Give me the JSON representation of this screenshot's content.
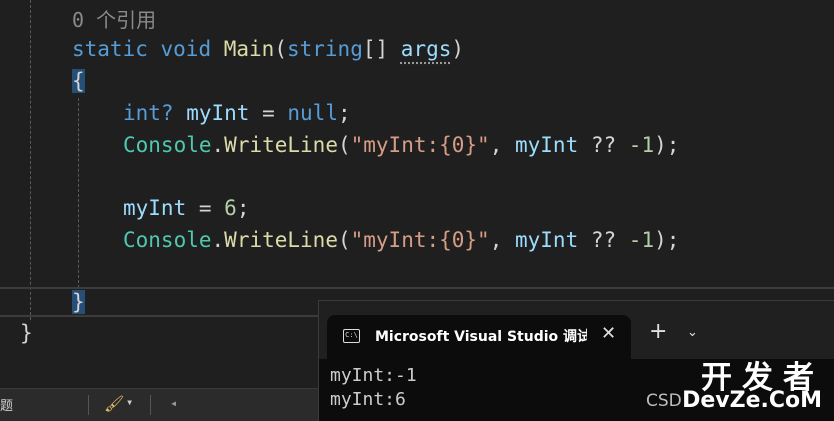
{
  "editor": {
    "codelens": "0 个引用",
    "lines": {
      "signature": {
        "kw1": "static",
        "kw2": "void",
        "fn": "Main",
        "p_open": "(",
        "kw3": "string",
        "arr": "[]",
        "param": "args",
        "p_close": ")"
      },
      "brace_open": "{",
      "line1": {
        "kw": "int?",
        "var": "myInt",
        "op": " = ",
        "val": "null",
        "end": ";"
      },
      "line2": {
        "type": "Console",
        "dot": ".",
        "fn": "WriteLine",
        "open": "(",
        "str": "\"myInt:{0}\"",
        "comma": ", ",
        "var": "myInt",
        "op": " ?? ",
        "num": "-1",
        "end": ");"
      },
      "line3": {
        "var": "myInt",
        "op": " = ",
        "num": "6",
        "end": ";"
      },
      "line4": {
        "type": "Console",
        "dot": ".",
        "fn": "WriteLine",
        "open": "(",
        "str": "\"myInt:{0}\"",
        "comma": ", ",
        "var": "myInt",
        "op": " ?? ",
        "num": "-1",
        "end": ");"
      },
      "brace_close": "}",
      "class_close": "}"
    }
  },
  "statusbar": {
    "fragment": "题",
    "brush_icon": "paintbrush-icon",
    "caret": "▾",
    "arrow": "◂"
  },
  "terminal": {
    "tab_icon": "console-icon",
    "tab_icon_text": "C:\\",
    "tab_title": "Microsoft Visual Studio 调试控制台",
    "close_glyph": "✕",
    "new_tab_glyph": "+",
    "dropdown_glyph": "⌄",
    "output": [
      "myInt:-1",
      "myInt:6"
    ]
  },
  "watermark": {
    "top": "开发者",
    "bottom": "DevZe.CoM",
    "csd": "CSD"
  }
}
